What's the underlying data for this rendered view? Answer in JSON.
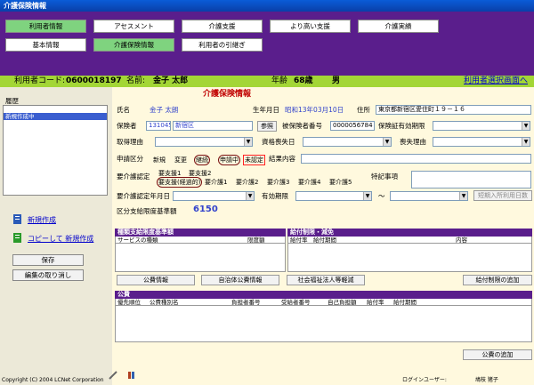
{
  "window": {
    "title": "介護保険情報"
  },
  "nav": {
    "row1": [
      "利用者情報",
      "アセスメント",
      "介護支援",
      "より高い支援",
      "介護実績"
    ],
    "row2": [
      "基本情報",
      "介護保険情報",
      "利用者の引継ぎ"
    ]
  },
  "user": {
    "code_label": "利用者コード:",
    "code": "0600018197",
    "name_label": "名前:",
    "name": "金子  太郎",
    "age_label": "年齢",
    "age": "68歳",
    "sex": "男",
    "select_link": "利用者選択画面へ"
  },
  "left": {
    "history_label": "履歴",
    "history_item": "新規作成中",
    "new": "新規作成",
    "copy_new": "コピーして 新規作成",
    "save": "保存",
    "cancel": "編集の取り消し"
  },
  "form": {
    "title": "介護保険情報",
    "name_label": "氏名",
    "name_value": "金子  太朗",
    "dob_label": "生年月日",
    "dob_value": "昭和13年03月10日",
    "addr_label": "住所",
    "addr_value": "東京都新宿区愛住町１９－１６",
    "insurer_label": "保険者",
    "insurer_code": "131045",
    "insurer_name": "新宿区",
    "ref_button": "参照",
    "insured_label": "被保険者番号",
    "insured_no": "0000056784",
    "period_label": "保険証有効期限",
    "acq_label": "取得理由",
    "loss_date_label": "資格喪失日",
    "loss_reason_label": "喪失理由",
    "app_label": "申請区分",
    "app_opts": [
      "新規",
      "変更",
      "継続",
      "申請中",
      "未認定"
    ],
    "result_label": "結果内容",
    "cert_label": "要介護認定",
    "cert_row1": [
      "要支援1",
      "要支援2"
    ],
    "cert_row2": [
      "要支援(経過的)",
      "要介護1",
      "要介護2",
      "要介護3",
      "要介護4",
      "要介護5"
    ],
    "special_label": "特記事項",
    "certdate_label": "要介護認定年月日",
    "valid_label": "有効期限",
    "tilde": "～",
    "short_btn": "短期入所利用日数",
    "limit_label": "区分支給限度基準額",
    "limit_value": "6150"
  },
  "panels": {
    "services_head": "種類支給限度基準額",
    "services_cols": [
      "サービスの種類",
      "限度額"
    ],
    "restrict_head": "給付制限・減免",
    "restrict_cols": [
      "給付率",
      "給付期間",
      "内容"
    ],
    "public_btn": "公費情報",
    "local_btn": "自治体公費情報",
    "social_btn": "社会福祉法人等軽減",
    "add_restrict": "給付制限の追加",
    "public_head": "公費",
    "public_cols": [
      "優先順位",
      "公費種別名",
      "負担者番号",
      "受給者番号",
      "自己負担額",
      "給付率",
      "給付期間"
    ],
    "add_public": "公費の追加"
  },
  "status": {
    "copyright": "Copyright (C) 2004 LCNet Corporation",
    "login_label": "ログインユーザー:",
    "login_user": "鳩枝  猪子"
  },
  "colors": {
    "purple": "#5a1e8c",
    "green": "#a3d636",
    "title": "#0a5cd8"
  }
}
